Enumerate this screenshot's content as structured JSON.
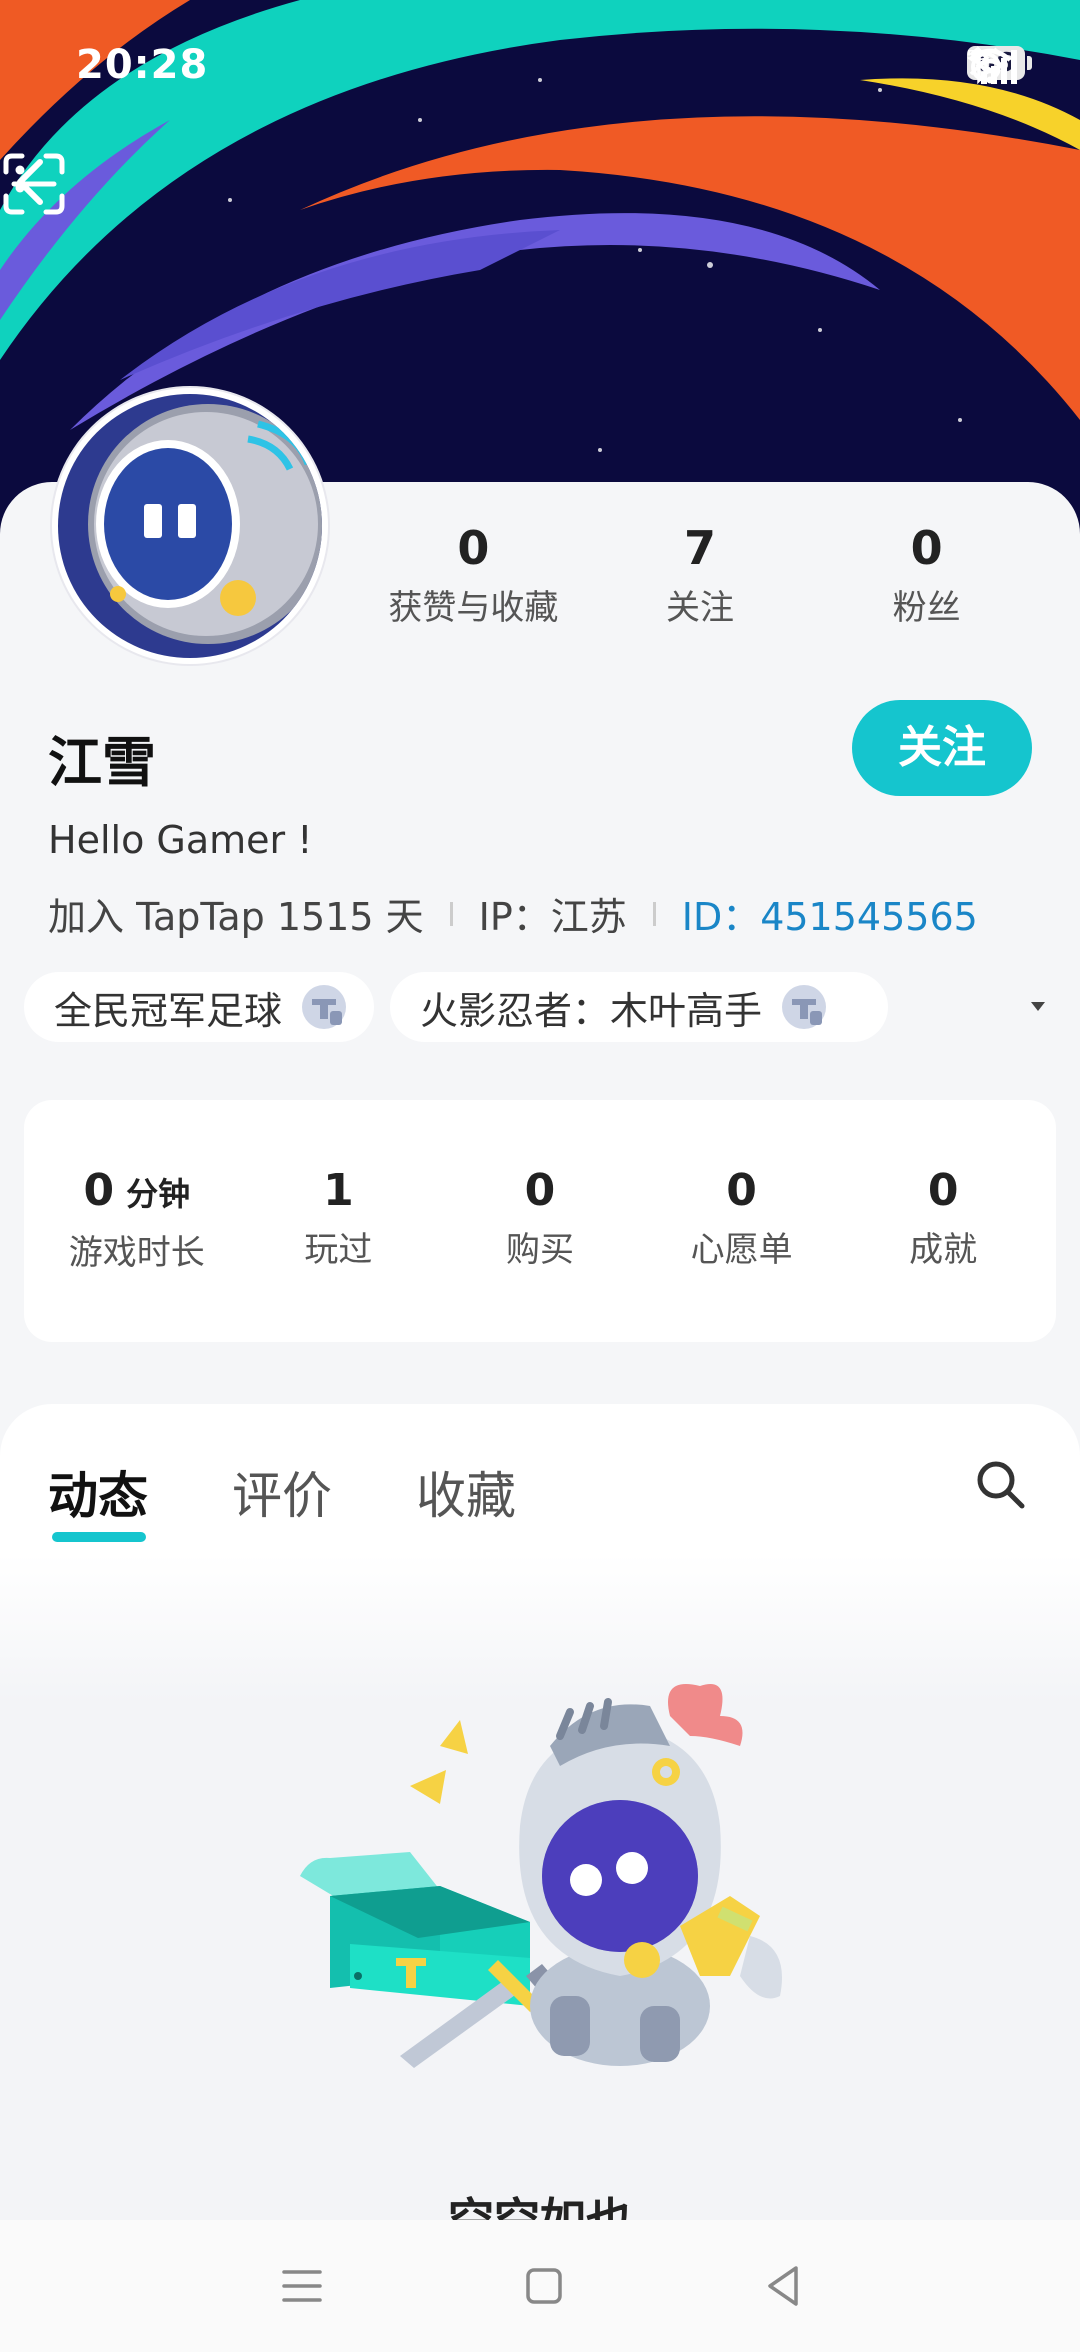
{
  "status_bar": {
    "time": "20:28",
    "network": "5G",
    "battery": "56"
  },
  "header": {
    "back_icon": "chevron-left-icon",
    "scan_icon": "scan-icon",
    "more_icon": "more-vertical-icon"
  },
  "profile": {
    "stats": [
      {
        "value": "0",
        "label": "获赞与收藏"
      },
      {
        "value": "7",
        "label": "关注"
      },
      {
        "value": "0",
        "label": "粉丝"
      }
    ],
    "name": "江雪",
    "follow_label": "关注",
    "bio": "Hello Gamer !",
    "joined": "加入 TapTap 1515 天",
    "ip": "IP：江苏",
    "id": "ID：451545565"
  },
  "tags": [
    {
      "label": "全民冠军足球"
    },
    {
      "label": "火影忍者：木叶高手"
    }
  ],
  "game_stats": [
    {
      "value": "0",
      "unit": "分钟",
      "label": "游戏时长"
    },
    {
      "value": "1",
      "label": "玩过"
    },
    {
      "value": "0",
      "label": "购买"
    },
    {
      "value": "0",
      "label": "心愿单"
    },
    {
      "value": "0",
      "label": "成就"
    }
  ],
  "tabs": [
    {
      "label": "动态",
      "active": true
    },
    {
      "label": "评价",
      "active": false
    },
    {
      "label": "收藏",
      "active": false
    }
  ],
  "empty_state": {
    "text": "空空如也"
  },
  "colors": {
    "accent": "#15c5ce",
    "id_link": "#1a86c7",
    "banner_bg": "#0b0a3e"
  }
}
